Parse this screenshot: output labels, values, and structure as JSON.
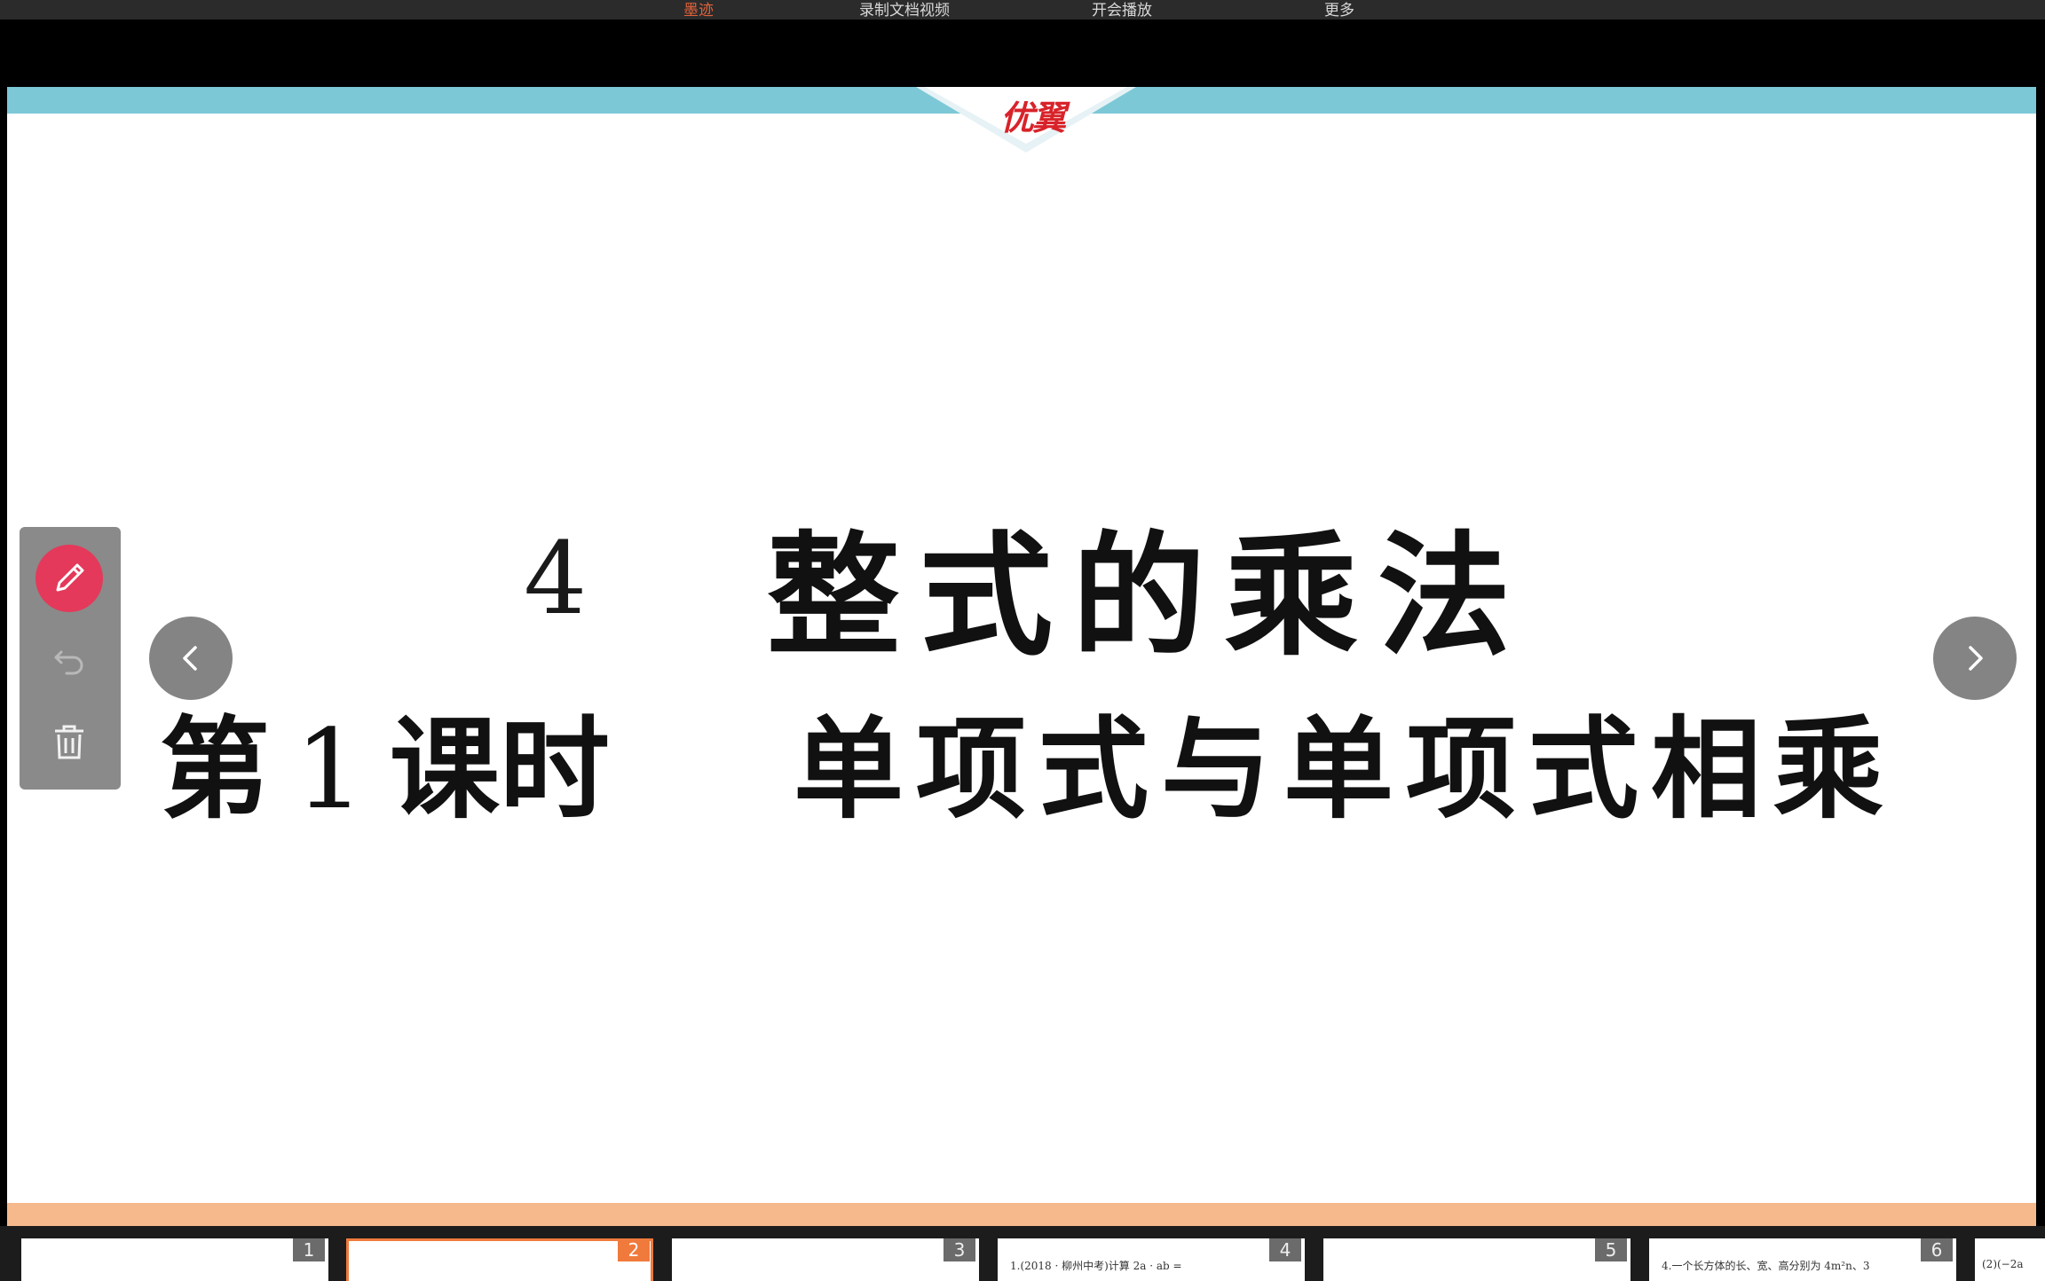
{
  "top_bar": {
    "items": [
      "墨迹",
      "录制文档视频",
      "开会播放",
      "更多"
    ],
    "active_index": 0,
    "active_color": "#e0623a"
  },
  "slide": {
    "logo": "优翼",
    "lesson_number": "4",
    "title": "整式的乘法",
    "subtitle_prefix": "第",
    "subtitle_number": "1",
    "subtitle_unit": "课时",
    "subtitle_topic": "单项式与单项式相乘"
  },
  "navigation": {
    "prev_icon": "chevron-left-icon",
    "next_icon": "chevron-right-icon"
  },
  "tools": {
    "items": [
      "pen-icon",
      "undo-icon",
      "trash-icon"
    ],
    "active": "pen-icon",
    "active_color": "#e4395a"
  },
  "thumbnails": {
    "selected_index": 1,
    "items": [
      {
        "number": "1",
        "text": ""
      },
      {
        "number": "2",
        "text": ""
      },
      {
        "number": "3",
        "text": ""
      },
      {
        "number": "4",
        "text": "1.(2018 · 柳州中考)计算 2a · ab ="
      },
      {
        "number": "5",
        "text": ""
      },
      {
        "number": "6",
        "text": "4.一个长方体的长、宽、高分别为 4m²n、3"
      },
      {
        "number": "",
        "text": "(2)(−2a"
      }
    ]
  }
}
